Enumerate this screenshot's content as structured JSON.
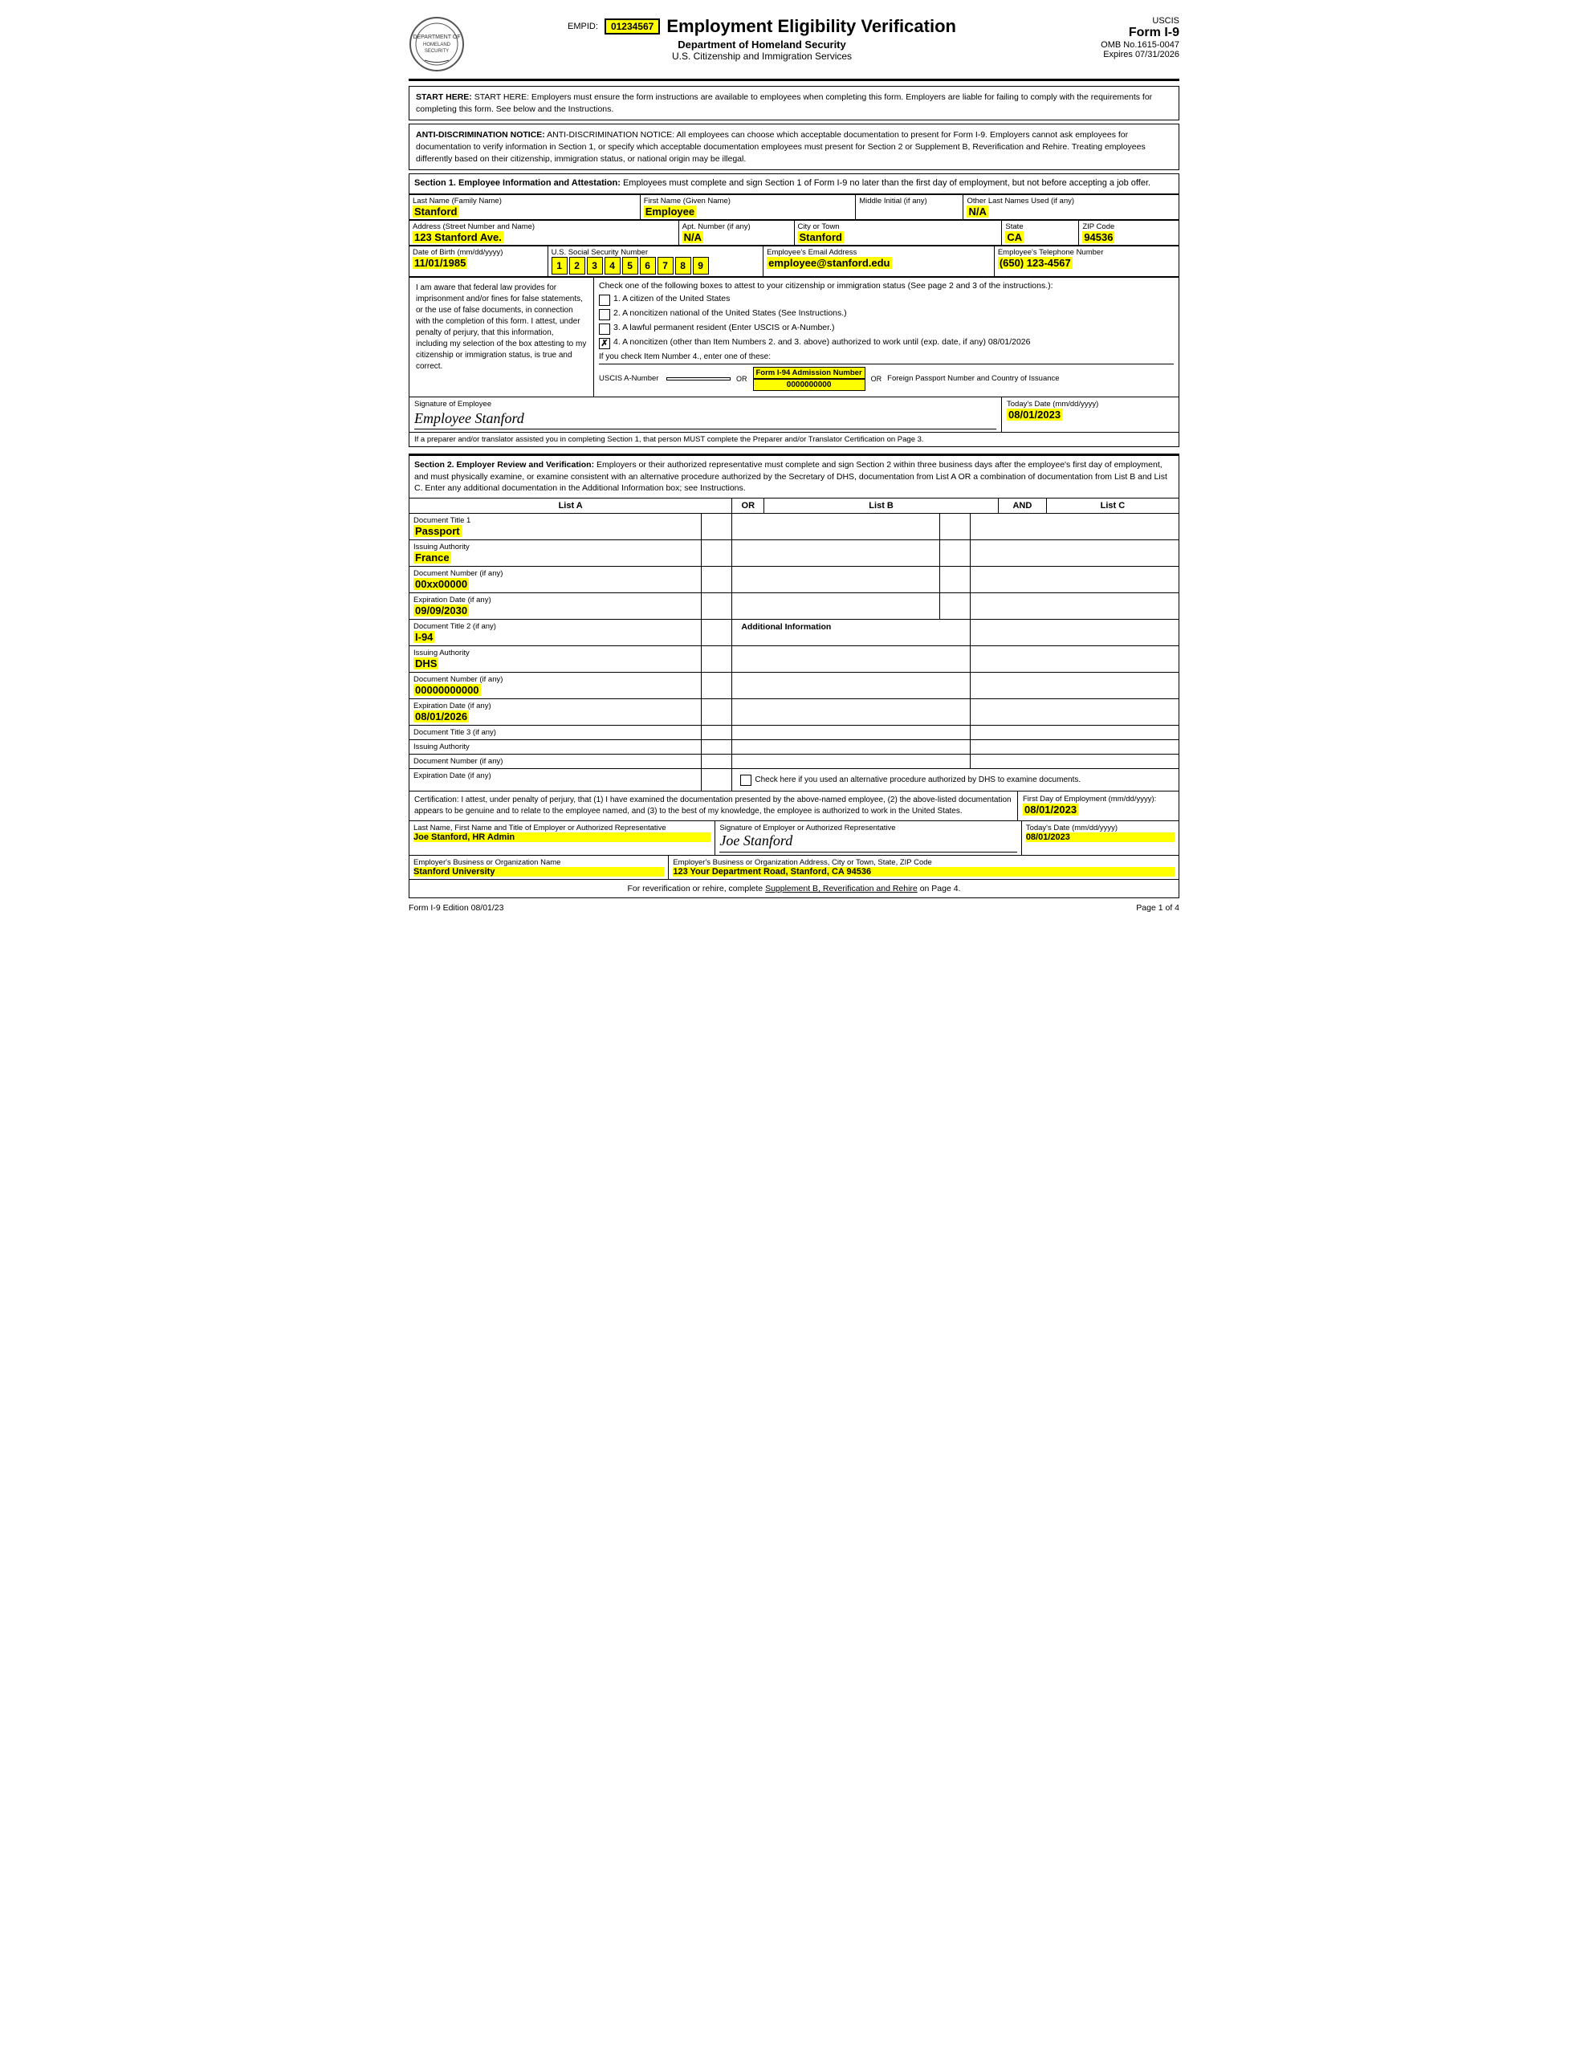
{
  "header": {
    "empid_label": "EMPID:",
    "empid_value": "01234567",
    "form_title": "Employment Eligibility Verification",
    "dept": "Department of Homeland Security",
    "agency": "U.S. Citizenship and Immigration Services",
    "uscis": "USCIS",
    "form_number": "Form I-9",
    "omb": "OMB No.1615-0047",
    "expires": "Expires 07/31/2026"
  },
  "notices": {
    "start_here": "START HERE:  Employers must ensure the form instructions are available to employees when completing this form. Employers are liable for failing to comply with the requirements for completing this form. See below and the Instructions.",
    "anti_disc": "ANTI-DISCRIMINATION NOTICE:  All employees can choose which acceptable documentation to present for Form I-9. Employers cannot ask employees for documentation to verify information in Section 1, or specify which acceptable documentation employees must present for Section 2 or Supplement B, Reverification and Rehire. Treating employees differently based on their citizenship, immigration status, or national origin may be illegal."
  },
  "section1": {
    "header": "Section 1. Employee Information and Attestation:",
    "header_text": " Employees must complete and sign Section 1 of Form I-9 no later than the first day of employment, but not before accepting a job offer.",
    "fields": {
      "last_name_label": "Last Name (Family Name)",
      "last_name": "Stanford",
      "first_name_label": "First Name (Given Name)",
      "first_name": "Employee",
      "middle_initial_label": "Middle Initial (if any)",
      "middle_initial": "",
      "other_names_label": "Other Last Names Used (if any)",
      "other_names": "N/A",
      "address_label": "Address (Street Number and Name)",
      "address": "123 Stanford Ave.",
      "apt_label": "Apt. Number (if any)",
      "apt": "N/A",
      "city_label": "City or Town",
      "city": "Stanford",
      "state_label": "State",
      "state": "CA",
      "zip_label": "ZIP Code",
      "zip": "94536",
      "dob_label": "Date of Birth (mm/dd/yyyy)",
      "dob": "11/01/1985",
      "ssn_label": "U.S. Social Security Number",
      "ssn_digits": [
        "1",
        "2",
        "3",
        "4",
        "5",
        "6",
        "7",
        "8",
        "9"
      ],
      "email_label": "Employee's Email Address",
      "email": "employee@stanford.edu",
      "phone_label": "Employee's Telephone Number",
      "phone": "(650) 123-4567"
    },
    "attestation": {
      "left_text": "I am aware that federal law provides for imprisonment and/or fines for false statements, or the use of false documents, in connection with the completion of this form. I attest, under penalty of perjury, that this information, including my selection of the box attesting to my citizenship or immigration status, is true and correct.",
      "check_intro": "Check one of the following boxes to attest to your citizenship or immigration status (See page 2 and 3 of the instructions.):",
      "options": [
        {
          "num": "1.",
          "text": "A citizen of the United States",
          "checked": false
        },
        {
          "num": "2.",
          "text": "A noncitizen national of the United States (See Instructions.)",
          "checked": false
        },
        {
          "num": "3.",
          "text": "A lawful permanent resident (Enter USCIS or A-Number.)",
          "checked": false
        },
        {
          "num": "4.",
          "text": "A noncitizen (other than Item Numbers 2. and 3. above) authorized to work until (exp. date, if any)",
          "checked": true
        }
      ],
      "work_until": "08/01/2026",
      "item4_note": "If you check Item Number 4., enter one of these:",
      "uscis_label": "USCIS A-Number",
      "uscis_value": "",
      "or1": "OR",
      "form94_label": "Form I-94 Admission Number",
      "form94_value": "0000000000",
      "or2": "OR",
      "passport_label": "Foreign Passport Number and Country of Issuance",
      "passport_value": ""
    },
    "signature": {
      "label": "Signature of Employee",
      "sig_image": "Employee Stanford",
      "date_label": "Today's Date (mm/dd/yyyy)",
      "date": "08/01/2023"
    },
    "preparer_note": "If a preparer and/or translator assisted you in completing Section 1, that person MUST complete the Preparer and/or Translator Certification on Page 3."
  },
  "section2": {
    "header": "Section 2. Employer Review and Verification:",
    "header_text": " Employers or their authorized representative must complete and sign Section 2 within three business days after the employee's first day of employment, and must physically examine, or examine consistent with an alternative procedure authorized by the Secretary of DHS, documentation from List A OR a combination of documentation from List B and List C. Enter any additional documentation in the Additional Information box; see Instructions.",
    "list_a_label": "List A",
    "or_label": "OR",
    "list_b_label": "List B",
    "and_label": "AND",
    "list_c_label": "List C",
    "doc1": {
      "title_label": "Document Title 1",
      "title": "Passport",
      "issuing_label": "Issuing Authority",
      "issuing": "France",
      "docnum_label": "Document Number (if any)",
      "docnum": "00xx00000",
      "expdate_label": "Expiration Date (if any)",
      "expdate": "09/09/2030"
    },
    "doc2": {
      "title_label": "Document Title 2 (if any)",
      "title": "I-94",
      "issuing_label": "Issuing Authority",
      "issuing": "DHS",
      "docnum_label": "Document Number (if any)",
      "docnum": "00000000000",
      "expdate_label": "Expiration Date (if any)",
      "expdate": "08/01/2026"
    },
    "doc3": {
      "title_label": "Document Title 3 (if any)",
      "title": "",
      "issuing_label": "Issuing Authority",
      "issuing": "",
      "docnum_label": "Document Number (if any)",
      "docnum": "",
      "expdate_label": "Expiration Date (if any)",
      "expdate": ""
    },
    "additional_info_label": "Additional Information",
    "alt_proc_label": "Check here if you used an alternative procedure authorized by DHS to examine documents."
  },
  "certification": {
    "text": "Certification: I attest, under penalty of perjury, that (1) I have examined the documentation presented by the above-named employee, (2) the above-listed documentation appears to be genuine and to relate to the employee named, and (3) to the best of my knowledge, the employee is authorized to work in the United States.",
    "first_day_label": "First Day of Employment (mm/dd/yyyy):",
    "first_day": "08/01/2023",
    "employer_name_label": "Last Name, First Name and Title of Employer or Authorized Representative",
    "employer_name": "Joe Stanford, HR Admin",
    "sig_label": "Signature of Employer or Authorized Representative",
    "sig_image": "Joe Stanford",
    "date_label": "Today's Date (mm/dd/yyyy)",
    "date": "08/01/2023",
    "org_name_label": "Employer's Business or Organization Name",
    "org_name": "Stanford University",
    "org_address_label": "Employer's Business or Organization Address, City or Town, State, ZIP Code",
    "org_address": "123 Your Department Road, Stanford, CA 94536"
  },
  "footer": {
    "reverif_note": "For reverification or rehire, complete",
    "reverif_link": "Supplement B, Reverification and Rehire",
    "reverif_end": "on Page 4.",
    "edition": "Form I-9  Edition  08/01/23",
    "page": "Page 1 of 4"
  }
}
